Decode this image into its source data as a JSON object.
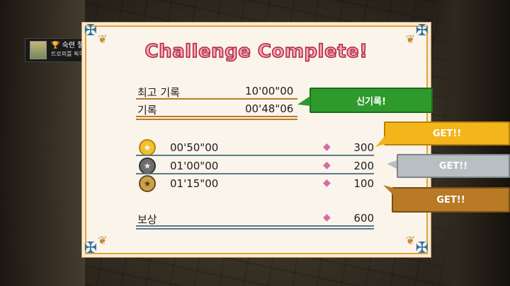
{
  "notification": {
    "title": "숙련 챌린저",
    "subtitle": "트로피를 획득했습니다!",
    "ps_symbol": "PS"
  },
  "panel": {
    "title": "Challenge Complete!",
    "best_label": "최고 기록",
    "best_value": "10'00\"00",
    "record_label": "기록",
    "record_value": "00'48\"06",
    "new_record_badge": "신기록!",
    "tiers": [
      {
        "medal": "gold",
        "time": "00'50\"00",
        "reward": "300",
        "badge": "GET!!"
      },
      {
        "medal": "silver",
        "time": "01'00\"00",
        "reward": "200",
        "badge": "GET!!"
      },
      {
        "medal": "bronze",
        "time": "01'15\"00",
        "reward": "100",
        "badge": "GET!!"
      }
    ],
    "total_label": "보상",
    "total_value": "600"
  },
  "colors": {
    "title_fill": "#f4a7b7",
    "title_stroke": "#b0243a",
    "new_record": "#2f9a2c",
    "gold": "#f3b51a",
    "silver": "#b8bfc2",
    "bronze": "#b87a25"
  }
}
